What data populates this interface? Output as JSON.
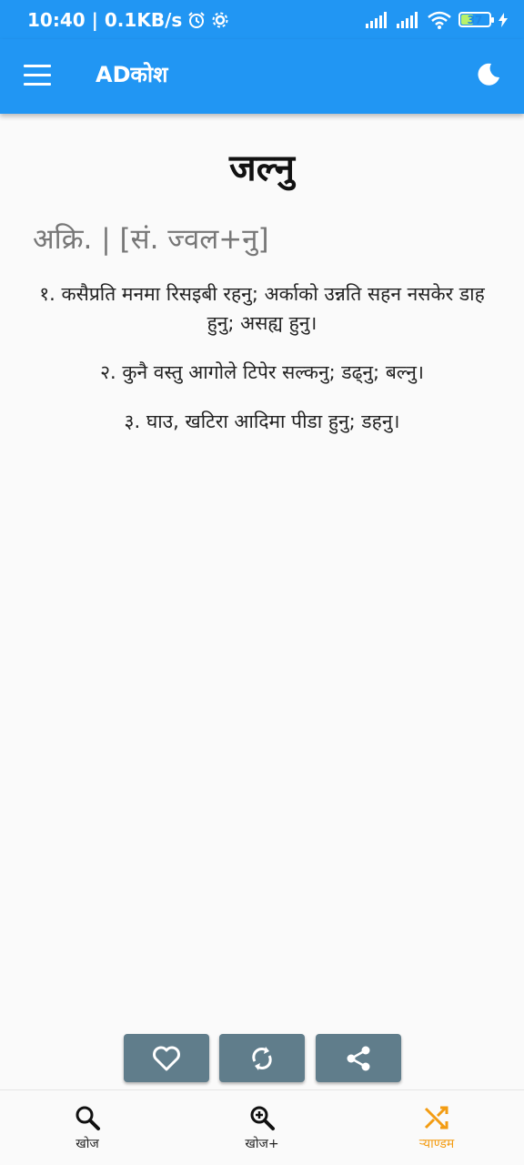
{
  "status_bar": {
    "time_speed": "10:40 | 0.1KB/s",
    "battery_level": "37"
  },
  "app_bar": {
    "title": "ADकोश"
  },
  "entry": {
    "headword": "जल्नु",
    "grammar": "अक्रि. | [सं. ज्वल+नु]",
    "definitions": [
      "१. कसैप्रति मनमा रिसइबी रहनु; अर्काको उन्नति सहन नसकेर डाह हुनु; असह्य हुनु।",
      "२. कुनै वस्तु आगोले टिपेर सल्कनु; डढ्नु; बल्नु।",
      "३. घाउ, खटिरा आदिमा पीडा हुनु; डहनु।"
    ]
  },
  "bottom_nav": {
    "items": [
      {
        "label": "खोज"
      },
      {
        "label": "खोज+"
      },
      {
        "label": "र्‍याण्डम"
      }
    ]
  },
  "colors": {
    "primary": "#2196f3",
    "action_button": "#607d8b",
    "active_nav": "#f39c12"
  }
}
